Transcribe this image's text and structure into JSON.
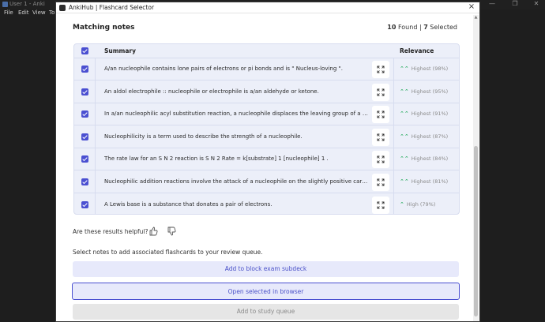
{
  "background": {
    "title": "User 1 - Anki",
    "menu": [
      "File",
      "Edit",
      "View",
      "To"
    ],
    "controls": [
      "—",
      "❐",
      "✕"
    ]
  },
  "dialog": {
    "title": "AnkiHub | Flashcard Selector",
    "close_icon": "×"
  },
  "header": {
    "title": "Matching notes",
    "found_count": "10",
    "found_label": " Found | ",
    "selected_count": "7",
    "selected_label": " Selected"
  },
  "table": {
    "columns": {
      "summary": "Summary",
      "relevance": "Relevance"
    },
    "rows": [
      {
        "summary": "A/an nucleophile contains lone pairs of electrons or pi bonds and is \" Nucleus-loving \".",
        "relevance": "Highest (98%)",
        "arrow": "double"
      },
      {
        "summary": "An aldol electrophile :: nucleophile or electrophile is a/an aldehyde or ketone.",
        "relevance": "Highest (95%)",
        "arrow": "double"
      },
      {
        "summary": "In a/an nucleophilic acyl substitution reaction, a nucleophile displaces the leaving group of a carbonyl compound.",
        "relevance": "Highest (91%)",
        "arrow": "double"
      },
      {
        "summary": "Nucleophilicity is a term used to describe the strength of a nucleophile.",
        "relevance": "Highest (87%)",
        "arrow": "double"
      },
      {
        "summary": "The rate law for an S N 2 reaction is S N 2 Rate = k[substrate] 1 [nucleophile] 1 .",
        "relevance": "Highest (84%)",
        "arrow": "double"
      },
      {
        "summary": "Nucleophilic addition reactions involve the attack of a nucleophile on the slightly positive carbon of a carbonyl group.",
        "relevance": "Highest (81%)",
        "arrow": "double"
      },
      {
        "summary": "A Lewis base is a substance that donates a pair of electrons.",
        "relevance": "High (79%)",
        "arrow": "single"
      }
    ]
  },
  "feedback": {
    "question": "Are these results helpful?"
  },
  "actions": {
    "hint": "Select notes to add associated flashcards to your review queue.",
    "subdeck": "Add to block exam subdeck",
    "browser": "Open selected in browser",
    "queue": "Add to study queue"
  },
  "colors": {
    "accent": "#4a4fd1",
    "relevance_green": "#2fae64",
    "row_bg": "#eceff9"
  }
}
